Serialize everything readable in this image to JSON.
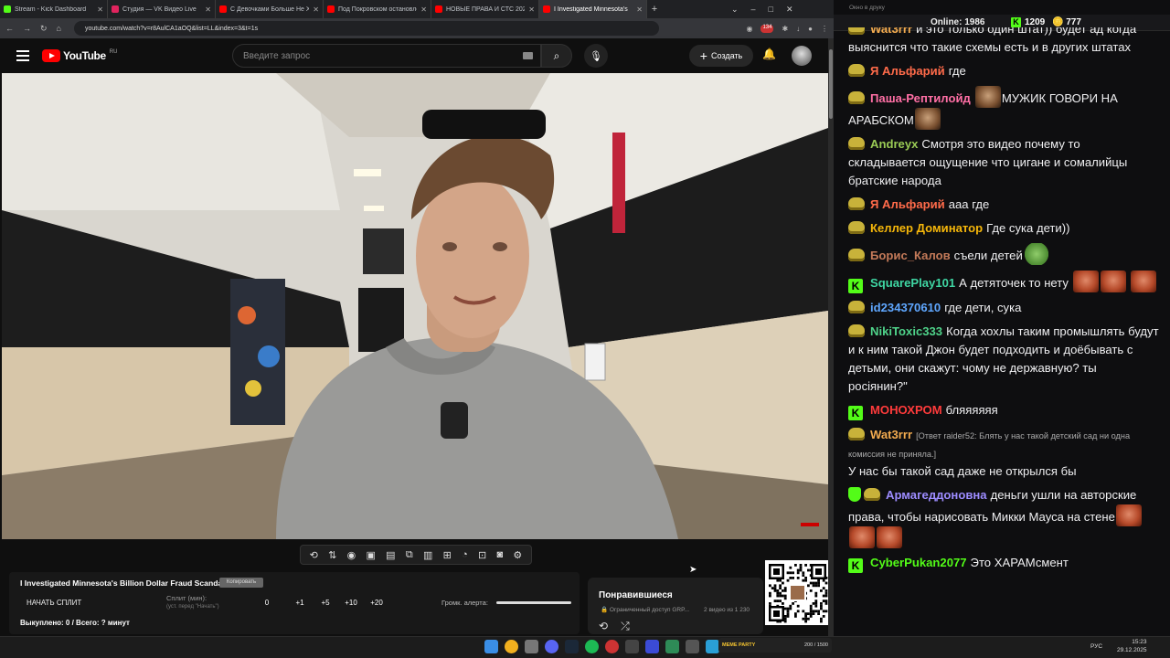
{
  "browser": {
    "tabs": [
      {
        "label": "Stream - Kick Dashboard",
        "color": "#53fc18",
        "active": false
      },
      {
        "label": "Студия — VK Видео Live",
        "color": "#e0245e",
        "active": false
      },
      {
        "label": "С Девочками Больше Не Хоч",
        "color": "#ff0000",
        "active": false
      },
      {
        "label": "Под Покровском остановлен",
        "color": "#ff0000",
        "active": false
      },
      {
        "label": "НОВЫЕ ПРАВА И СТС 2026! и",
        "color": "#ff0000",
        "active": false
      },
      {
        "label": "I Investigated Minnesota's",
        "color": "#ff0000",
        "active": true
      }
    ],
    "url": "youtube.com/watch?v=r8AulCA1aOQ&list=LL&index=3&t=1s",
    "badge_count": "134"
  },
  "youtube": {
    "region": "RU",
    "logo_text": "YouTube",
    "search_placeholder": "Введите запрос",
    "create_label": "Создать"
  },
  "panel": {
    "video_title": "I Investigated Minnesota's Billion Dollar Fraud Scandal",
    "badge": "Копировать",
    "start_split": "НАЧАТЬ СПЛИТ",
    "split_label": "Сплит (мин):",
    "split_hint": "(уст. перед \"Начать\")",
    "split_values": [
      "0",
      "+1",
      "+5",
      "+10",
      "+20"
    ],
    "volume_label": "Громк. алерта:",
    "bought": "Выкуплено: 0 / Всего: ? минут"
  },
  "liked": {
    "title": "Понравившиеся",
    "sub": "Ограниченный доступ GRP...",
    "count": "2 видео из 1 230"
  },
  "chat": {
    "window_title": "Окно в друку",
    "online_label": "Online:",
    "online_count": "1986",
    "kick_count": "1209",
    "coin_count": "777",
    "messages": [
      {
        "nick": "Wat3rrr",
        "color": "#f3ab4f",
        "text": "и это только один штат)) будет ад когда выяснится что такие схемы есть и в других штатах"
      },
      {
        "nick": "Я Альфарий",
        "color": "#ff6b4a",
        "text": "где"
      },
      {
        "nick": "Паша-Рептилойд",
        "color": "#ff6fa5",
        "text": "МУЖИК ГОВОРИ НА АРАБСКОМ"
      },
      {
        "nick": "Andreyx",
        "color": "#9acb55",
        "text": "Смотря это видео почему то складывается ощущение что цигане и сомалийцы братские народа"
      },
      {
        "nick": "Я Альфарий",
        "color": "#ff6b4a",
        "text": "ааа где"
      },
      {
        "nick": "Келлер Доминатор",
        "color": "#f6b70a",
        "text": "Где сука дети))"
      },
      {
        "nick": "Борис_Калов",
        "color": "#c47a59",
        "text": "съели детей"
      },
      {
        "nick": "SquarePlay101",
        "color": "#3fd6a3",
        "text": "А детяточек то нету"
      },
      {
        "nick": "id234370610",
        "color": "#5fa7ff",
        "text": "где дети, сука"
      },
      {
        "nick": "NikiToxic333",
        "color": "#4fd38a",
        "text": "Когда хохлы таким промышлять будут и к ним такой Джон будет подходить и доёбывать с детьми, они скажут: чому не державную? ты росіянин?\""
      },
      {
        "nick": "МОНОХРОМ",
        "color": "#ff3b3b",
        "text": "бляяяяяя"
      },
      {
        "nick": "Wat3rrr",
        "color": "#f3ab4f",
        "reply": "[Ответ raider52: Блять у нас такой детский сад ни одна комиссия не приняла.]",
        "text": "У нас бы такой сад даже не открылся бы"
      },
      {
        "nick": "Армагеддоновна",
        "color": "#9d8cff",
        "text": "деньги ушли на авторские права, чтобы нарисовать Микки Мауса на стене"
      },
      {
        "nick": "CyberPukan2077",
        "color": "#53fc18",
        "text": "Это ХАРАМсмент"
      }
    ]
  },
  "taskbar": {
    "tray_title": "MEME PARTY",
    "tray_progress": "200 / 1500",
    "lang": "РУС",
    "time": "15:23",
    "date": "29.12.2025"
  }
}
